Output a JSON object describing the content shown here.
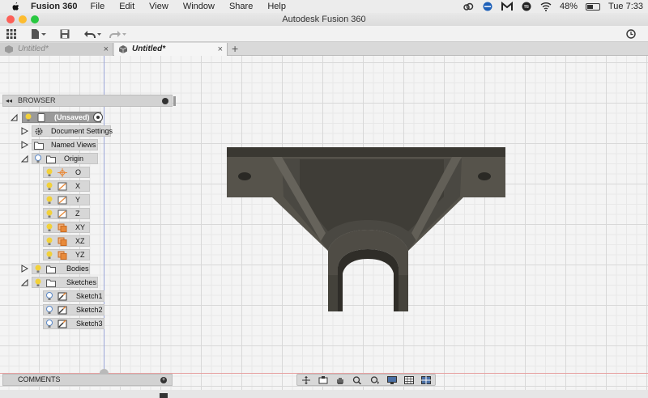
{
  "menubar": {
    "app_name": "Fusion 360",
    "items": [
      "File",
      "Edit",
      "View",
      "Window",
      "Share",
      "Help"
    ],
    "battery": "48%",
    "clock": "Tue 7:33"
  },
  "window": {
    "title": "Autodesk Fusion 360"
  },
  "tabs": [
    {
      "label": "Untitled*",
      "active": false,
      "close": "×"
    },
    {
      "label": "Untitled*",
      "active": true,
      "close": "×"
    }
  ],
  "tab_add": "+",
  "browser": {
    "title": "BROWSER",
    "root": "(Unsaved)",
    "document_settings": "Document Settings",
    "named_views": "Named Views",
    "origin": "Origin",
    "origin_items": [
      "O",
      "X",
      "Y",
      "Z",
      "XY",
      "XZ",
      "YZ"
    ],
    "bodies": "Bodies",
    "sketches": "Sketches",
    "sketch_items": [
      "Sketch1",
      "Sketch2",
      "Sketch3"
    ]
  },
  "comments": {
    "title": "COMMENTS"
  },
  "colors": {
    "accent_bulb": "#f2d13a",
    "plane_orange": "#e88a3a",
    "model_body": "#57544c",
    "model_dark": "#3b3933"
  }
}
